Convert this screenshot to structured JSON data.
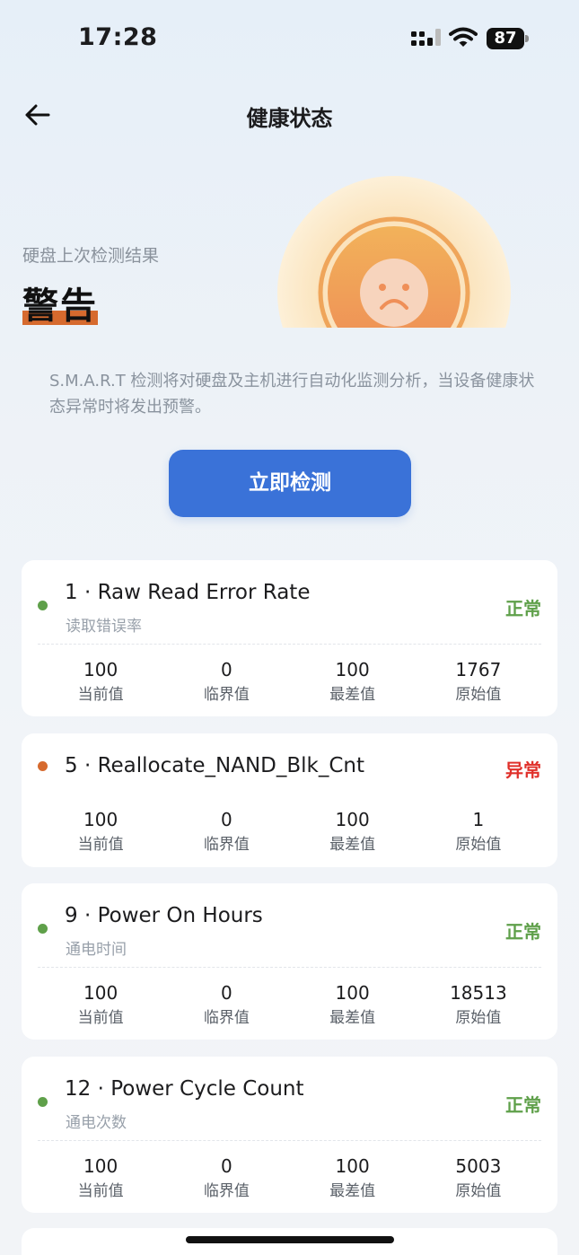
{
  "status_bar": {
    "time": "17:28",
    "battery": "87"
  },
  "nav": {
    "title": "健康状态"
  },
  "hero": {
    "subtitle": "硬盘上次检测结果",
    "status": "警告"
  },
  "description": "S.M.A.R.T 检测将对硬盘及主机进行自动化监测分析，当设备健康状态异常时将发出预警。",
  "check_button": "立即检测",
  "colors": {
    "accent": "#3a72d8",
    "normal": "#5fa04a",
    "abnormal": "#e0302a",
    "warning_dot": "#d66a2e",
    "gauge": "#f0a35a"
  },
  "attributes": [
    {
      "title": "1 · Raw Read Error Rate",
      "subtitle": "读取错误率",
      "status": "正常",
      "dot": "#5fa04a",
      "metrics": [
        {
          "value": "100",
          "label": "当前值"
        },
        {
          "value": "0",
          "label": "临界值"
        },
        {
          "value": "100",
          "label": "最差值"
        },
        {
          "value": "1767",
          "label": "原始值"
        }
      ]
    },
    {
      "title": "5 · Reallocate_NAND_Blk_Cnt",
      "subtitle": "",
      "status": "异常",
      "dot": "#d66a2e",
      "metrics": [
        {
          "value": "100",
          "label": "当前值"
        },
        {
          "value": "0",
          "label": "临界值"
        },
        {
          "value": "100",
          "label": "最差值"
        },
        {
          "value": "1",
          "label": "原始值"
        }
      ]
    },
    {
      "title": "9 · Power On Hours",
      "subtitle": "通电时间",
      "status": "正常",
      "dot": "#5fa04a",
      "metrics": [
        {
          "value": "100",
          "label": "当前值"
        },
        {
          "value": "0",
          "label": "临界值"
        },
        {
          "value": "100",
          "label": "最差值"
        },
        {
          "value": "18513",
          "label": "原始值"
        }
      ]
    },
    {
      "title": "12 · Power Cycle Count",
      "subtitle": "通电次数",
      "status": "正常",
      "dot": "#5fa04a",
      "metrics": [
        {
          "value": "100",
          "label": "当前值"
        },
        {
          "value": "0",
          "label": "临界值"
        },
        {
          "value": "100",
          "label": "最差值"
        },
        {
          "value": "5003",
          "label": "原始值"
        }
      ]
    }
  ]
}
